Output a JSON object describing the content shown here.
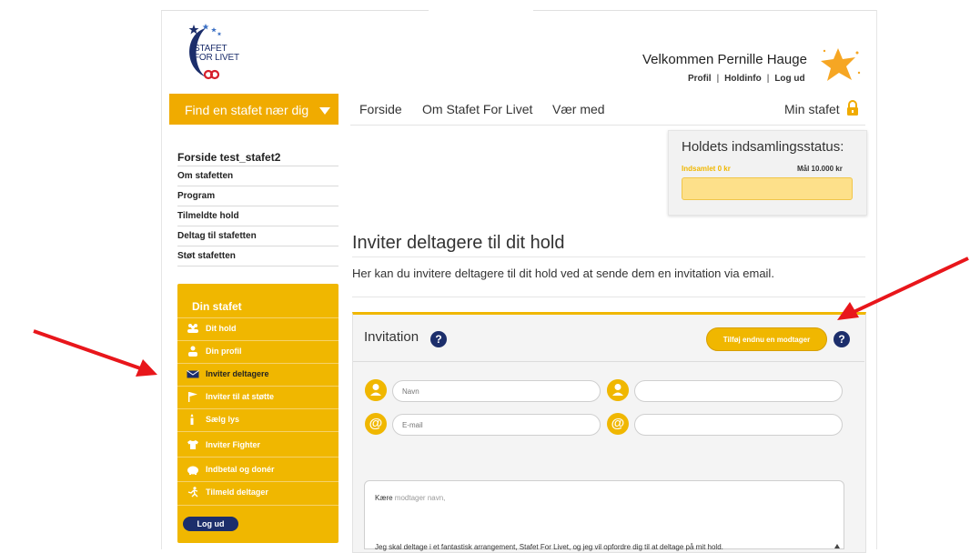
{
  "brand": {
    "logo_line1": "STAFET",
    "logo_line2": "FOR LIVET",
    "navy": "#1c2e6b",
    "yellow": "#f0b700",
    "arrow_red": "#e8161b"
  },
  "header": {
    "welcome": "Velkommen Pernille Hauge",
    "links": [
      "Profil",
      "Holdinfo",
      "Log ud"
    ],
    "separator": "|"
  },
  "nav": {
    "find_label": "Find en stafet nær dig",
    "items": [
      "Forside",
      "Om Stafet For Livet",
      "Vær med"
    ],
    "min_stafet": "Min stafet"
  },
  "left_menu": {
    "title": "Forside test_stafet2",
    "items": [
      "Om stafetten",
      "Program",
      "Tilmeldte hold",
      "Deltag til stafetten",
      "Støt stafetten"
    ]
  },
  "din_stafet": {
    "title": "Din stafet",
    "items": [
      {
        "label": "Dit hold",
        "icon": "team-icon"
      },
      {
        "label": "Din profil",
        "icon": "person-icon"
      },
      {
        "label": "Inviter deltagere",
        "icon": "envelope-icon"
      },
      {
        "label": "Inviter til at støtte",
        "icon": "flag-icon"
      },
      {
        "label": "Sælg lys",
        "icon": "candle-icon"
      },
      {
        "label": "Inviter Fighter",
        "icon": "shirt-icon"
      },
      {
        "label": "Indbetal og donér",
        "icon": "piggy-bank-icon"
      },
      {
        "label": "Tilmeld deltager",
        "icon": "runner-icon"
      }
    ],
    "logout": "Log ud"
  },
  "status": {
    "title": "Holdets indsamlingsstatus:",
    "collected": "Indsamlet 0 kr",
    "goal": "Mål 10.000 kr",
    "progress": 0
  },
  "main": {
    "heading": "Inviter deltagere til dit hold",
    "intro": "Her kan du invitere deltagere til dit hold ved at sende dem en invitation via email."
  },
  "invitation": {
    "title": "Invitation",
    "help": "?",
    "add_button": "Tilføj endnu en modtager",
    "name_placeholder": "Navn",
    "email_placeholder": "E-mail",
    "name2_value": "",
    "email2_value": "",
    "at_symbol": "@",
    "msg_greeting": "Kære",
    "msg_greeting_ph": "modtager navn,",
    "msg_body": "Jeg skal deltage i et fantastisk arrangement, Stafet For Livet, og jeg vil opfordre dig til at deltage på mit hold."
  }
}
